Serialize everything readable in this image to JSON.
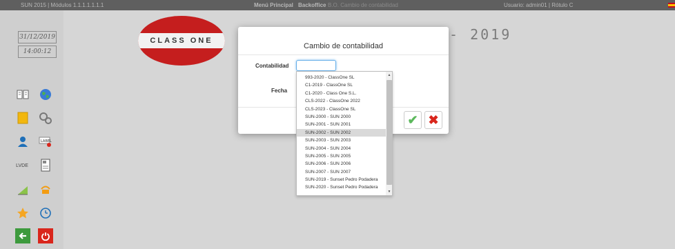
{
  "topbar": {
    "version": "SUN 2015 | Módulos 1.1.1.1.1.1.1",
    "menu_principal": "Menú Principal",
    "backoffice": "Backoffice",
    "breadcrumb_extra": "B.O. Cambio de contabilidad",
    "user": "Usuario: admin01 | Rótulo C"
  },
  "sidebar": {
    "date": "31/12/2019",
    "time": "14:00:12",
    "lvde_label": "LVDE",
    "label_icon_text": "LABEL"
  },
  "logo": {
    "text": "CLASS ONE"
  },
  "page": {
    "title_visible": "- 2019"
  },
  "modal": {
    "title": "Cambio de contabilidad",
    "contabilidad_label": "Contabilidad",
    "contabilidad_value": "",
    "fecha_label": "Fecha"
  },
  "dropdown": {
    "options": [
      "993-2020 - ClassOne SL",
      "C1-2019 - ClassOne SL",
      "C1-2020 - Class One S.L.",
      "CLS-2022 - ClassOne 2022",
      "CLS-2023 - ClassOne SL",
      "SUN-2000 - SUN 2000",
      "SUN-2001 - SUN 2001",
      "SUN-2002 - SUN 2002",
      "SUN-2003 - SUN 2003",
      "SUN-2004 - SUN 2004",
      "SUN-2005 - SUN 2005",
      "SUN-2006 - SUN 2006",
      "SUN-2007 - SUN 2007",
      "SUN-2019 - Sunset Pedro Podadera",
      "SUN-2020 - Sunset Pedro Podadera"
    ],
    "highlighted": "SUN-2002 - SUN 2002"
  },
  "colors": {
    "accept": "#5cb85c",
    "cancel": "#d9261c",
    "exit": "#d9261c",
    "back": "#3d9a3d",
    "logo_red": "#c51e1e"
  }
}
